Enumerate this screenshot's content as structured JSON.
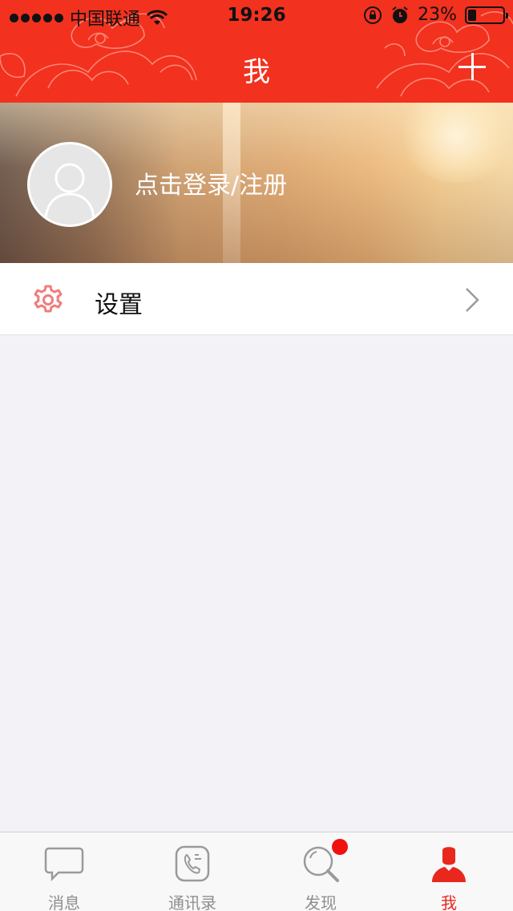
{
  "status_bar": {
    "carrier": "中国联通",
    "time": "19:26",
    "battery": "23%",
    "battery_level": 0.23
  },
  "header": {
    "title": "我",
    "add_icon": "plus-icon",
    "background_color": "#f2311f"
  },
  "profile": {
    "login_text": "点击登录/注册",
    "avatar_icon": "default-avatar-icon"
  },
  "menu": {
    "settings_label": "设置",
    "settings_icon": "gear-icon",
    "settings_icon_color": "#f07c7c"
  },
  "tabbar": {
    "tabs": [
      {
        "label": "消息",
        "icon": "chat-bubble-icon"
      },
      {
        "label": "通讯录",
        "icon": "phone-book-icon"
      },
      {
        "label": "发现",
        "icon": "magnifier-icon"
      },
      {
        "label": "我",
        "icon": "person-icon"
      }
    ],
    "active_tab": "我",
    "active_color": "#e8281c",
    "inactive_color": "#8e8e8e"
  }
}
